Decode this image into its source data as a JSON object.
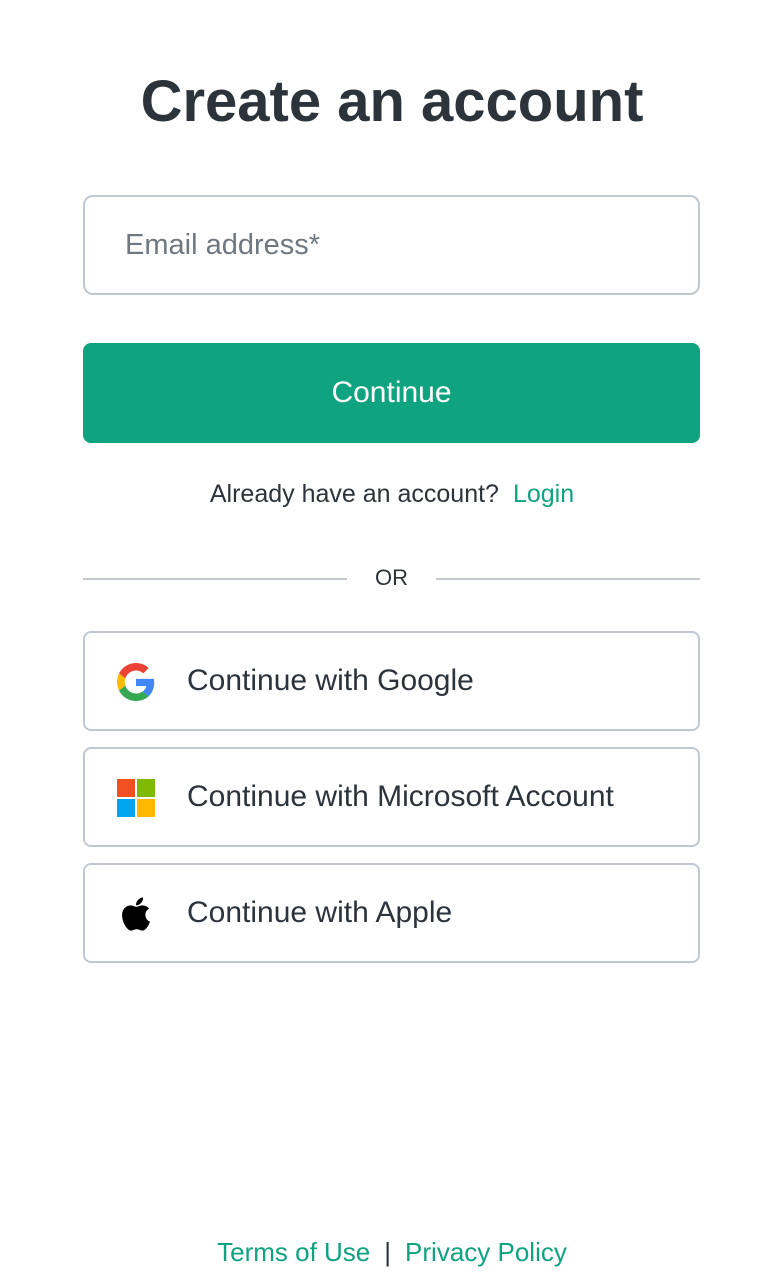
{
  "page": {
    "title": "Create an account"
  },
  "form": {
    "email_placeholder": "Email address*",
    "email_value": "",
    "continue_label": "Continue"
  },
  "login_prompt": {
    "text": "Already have an account?",
    "link_label": "Login"
  },
  "divider": {
    "label": "OR"
  },
  "social_buttons": [
    {
      "label": "Continue with Google",
      "icon": "google-icon"
    },
    {
      "label": "Continue with Microsoft Account",
      "icon": "microsoft-icon"
    },
    {
      "label": "Continue with Apple",
      "icon": "apple-icon"
    }
  ],
  "footer": {
    "terms_label": "Terms of Use",
    "separator": "|",
    "privacy_label": "Privacy Policy"
  },
  "colors": {
    "accent": "#10a37f",
    "text": "#2d333a",
    "border": "#c2c8d0",
    "google_blue": "#4285F4",
    "google_red": "#EA4335",
    "google_yellow": "#FBBC05",
    "google_green": "#34A853",
    "ms_red": "#F25022",
    "ms_green": "#7FBA00",
    "ms_blue": "#00A4EF",
    "ms_yellow": "#FFB900"
  }
}
